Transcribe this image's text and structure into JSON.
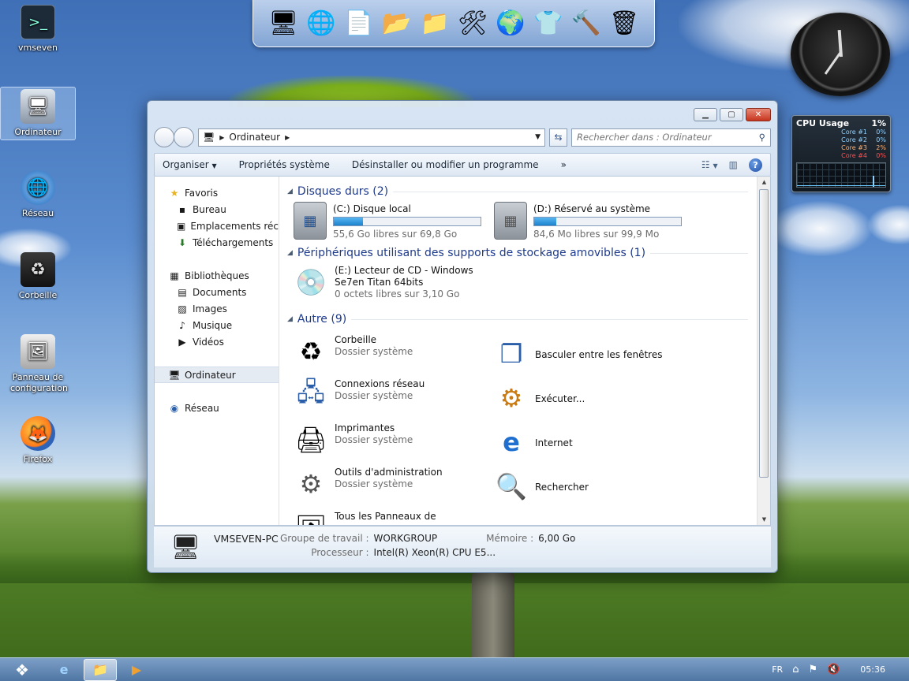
{
  "desktop": {
    "icons": [
      {
        "label": "vmseven",
        "icon": "terminal-icon"
      },
      {
        "label": "Ordinateur",
        "icon": "computer-icon"
      },
      {
        "label": "Réseau",
        "icon": "network-icon"
      },
      {
        "label": "Corbeille",
        "icon": "recycle-bin-icon"
      },
      {
        "label": "Panneau de configuration",
        "icon": "control-panel-icon"
      },
      {
        "label": "Firefox",
        "icon": "firefox-icon"
      }
    ]
  },
  "dock": {
    "items": [
      "computer-icon",
      "network-globe-icon",
      "documents-folder-icon",
      "pictures-folder-icon",
      "music-folder-icon",
      "tools-icon",
      "internet-icon",
      "shirt-icon",
      "admin-tools-icon",
      "recycle-bin-icon"
    ]
  },
  "cpu_gadget": {
    "title": "CPU Usage",
    "total": "1%",
    "cores": [
      {
        "name": "Core #1",
        "value": "0%",
        "color": "#8fd0ff"
      },
      {
        "name": "Core #2",
        "value": "0%",
        "color": "#8fd0ff"
      },
      {
        "name": "Core #3",
        "value": "2%",
        "color": "#ffb070"
      },
      {
        "name": "Core #4",
        "value": "0%",
        "color": "#ff5050"
      }
    ]
  },
  "window": {
    "address": {
      "location": "Ordinateur"
    },
    "search": {
      "placeholder": "Rechercher dans : Ordinateur"
    },
    "toolbar": {
      "organize": "Organiser",
      "system_properties": "Propriétés système",
      "uninstall": "Désinstaller ou modifier un programme",
      "more": "»"
    },
    "nav": {
      "favorites": "Favoris",
      "fav_items": [
        "Bureau",
        "Emplacements récents",
        "Téléchargements"
      ],
      "libraries": "Bibliothèques",
      "lib_items": [
        "Documents",
        "Images",
        "Musique",
        "Vidéos"
      ],
      "computer": "Ordinateur",
      "network": "Réseau"
    },
    "groups": {
      "hard_drives": "Disques durs (2)",
      "removable": "Périphériques utilisant des supports de stockage amovibles (1)",
      "other": "Autre (9)"
    },
    "drives": [
      {
        "name": "(C:) Disque local",
        "free": "55,6 Go libres sur 69,8 Go",
        "used_fraction": 0.2
      },
      {
        "name": "(D:) Réservé au système",
        "free": "84,6 Mo libres sur 99,9 Mo",
        "used_fraction": 0.15
      }
    ],
    "cd": {
      "name_line1": "(E:) Lecteur de CD - Windows",
      "name_line2": "Se7en Titan 64bits",
      "free": "0 octets libres sur 3,10 Go"
    },
    "other_items": [
      {
        "name": "Corbeille",
        "sub": "Dossier système",
        "icon": "recycle-bin-icon"
      },
      {
        "name": "Basculer entre les fenêtres",
        "sub": "",
        "icon": "switch-windows-icon"
      },
      {
        "name": "Connexions réseau",
        "sub": "Dossier système",
        "icon": "network-connections-icon"
      },
      {
        "name": "Exécuter...",
        "sub": "",
        "icon": "run-icon"
      },
      {
        "name": "Imprimantes",
        "sub": "Dossier système",
        "icon": "printer-icon"
      },
      {
        "name": "Internet",
        "sub": "",
        "icon": "internet-explorer-icon"
      },
      {
        "name": "Outils d'administration",
        "sub": "Dossier système",
        "icon": "admin-tools-icon"
      },
      {
        "name": "Rechercher",
        "sub": "",
        "icon": "search-icon"
      },
      {
        "name": "Tous les Panneaux de",
        "sub": "",
        "icon": "control-panel-icon"
      }
    ],
    "details": {
      "pc_name": "VMSEVEN-PC",
      "workgroup_label": "Groupe de travail :",
      "workgroup_value": "WORKGROUP",
      "memory_label": "Mémoire :",
      "memory_value": "6,00 Go",
      "processor_label": "Processeur :",
      "processor_value": "Intel(R) Xeon(R) CPU E5..."
    }
  },
  "taskbar": {
    "language": "FR",
    "time": "05:36"
  }
}
